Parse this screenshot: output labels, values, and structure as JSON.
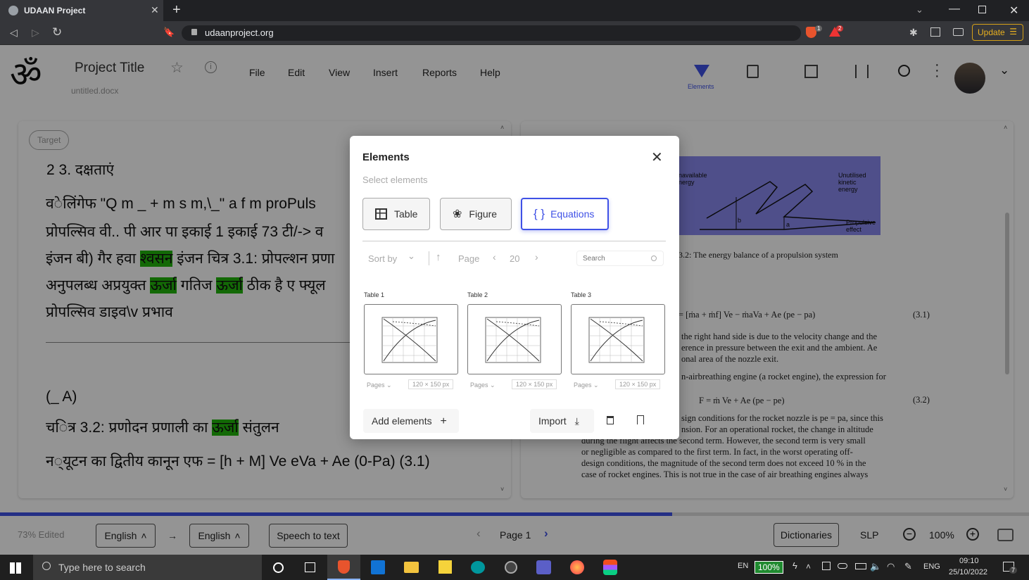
{
  "browser": {
    "tab_title": "UDAAN Project",
    "url": "udaanproject.org",
    "update_label": "Update",
    "brave_badge": "1",
    "alert_badge": "2"
  },
  "app": {
    "project_title": "Project Title",
    "file_name": "untitled.docx",
    "menu": [
      "File",
      "Edit",
      "View",
      "Insert",
      "Reports",
      "Help"
    ],
    "elements_label": "Elements"
  },
  "left_panel": {
    "target_label": "Target",
    "lines": [
      "2 3. दक्षताएं",
      "व◌ेलिंगेफ \"Q m _ + m s m,\\_\" a f m proPuls",
      "प्रोपल्सिव वी.. पी आर पा इकाई 1 इकाई 73 टी/-> व",
      "इंजन बी) गैर हवा",
      "अनुपलब्ध अप्रयुक्त",
      "प्रोपल्सिव डाइव\\v प्रभाव",
      "(_ A)",
      "च◌ित्र 3.2: प्रणोदन प्रणाली का",
      "न◌्यूटन का द्वितीय कानून एफ = [h + M] Ve eVa + Ae (0-Pa) (3.1)"
    ],
    "hl1": "श्वसन",
    "l4_rest": " इंजन चित्र 3.1: प्रोपल्शन प्रणा",
    "hl2": "ऊर्जा",
    "l5_mid": " गतिज ",
    "hl3": "ऊर्जा",
    "l5_rest": " ठीक है ए फ्यूल",
    "hl4": "ऊर्जा",
    "l8_rest": " संतुलन"
  },
  "right_panel": {
    "fig_labels": [
      "navailable",
      "nergy",
      "Unutilised",
      "kinetic",
      "energy",
      "Propulsive",
      "effect",
      "b",
      "a"
    ],
    "caption": "3.2: The energy balance of a propulsion system",
    "eq1": "= [ṁa + ṁf] Ve − ṁaVa + Ae (pe − pa)",
    "eq1_no": "(3.1)",
    "text1": [
      "the right hand side is due to the velocity change and the",
      "erence in pressure between the exit and the ambient. Ae",
      "onal area of the nozzle exit.",
      "n-airbreathing engine (a rocket engine), the expression for"
    ],
    "eq2": "F = ṁ Ve + Ae (pe − pe)",
    "eq2_no": "(3.2)",
    "text2": [
      "sign conditions for the rocket nozzle is pe = pa, since this",
      "nsion. For an operational rocket, the change in altitude",
      "during the flight affects the second term. However, the second term is very small",
      "or negligible as compared to the first term. In fact, in the worst operating off-",
      "design conditions, the magnitude of the second term does not exceed 10 % in the",
      "case of rocket engines. This is not true in the case of air breathing engines always"
    ]
  },
  "modal": {
    "title": "Elements",
    "subtitle": "Select elements",
    "types": [
      "Table",
      "Figure",
      "Equations"
    ],
    "sort_label": "Sort by",
    "page_label": "Page",
    "page_value": "20",
    "search_placeholder": "Search",
    "items": [
      {
        "label": "Table 1",
        "pages": "Pages",
        "size": "120 × 150 px"
      },
      {
        "label": "Table 2",
        "pages": "Pages",
        "size": "120 × 150 px"
      },
      {
        "label": "Table 3",
        "pages": "Pages",
        "size": "120 × 150 px"
      }
    ],
    "add_label": "Add elements",
    "import_label": "Import"
  },
  "bottom": {
    "edited": "73% Edited",
    "lang_from": "English",
    "lang_to": "English",
    "speech": "Speech to text",
    "page": "Page 1",
    "dictionaries": "Dictionaries",
    "slp": "SLP",
    "zoom": "100%",
    "progress": 0.653
  },
  "taskbar": {
    "search_placeholder": "Type here to search",
    "lang_short": "EN",
    "battery": "100%",
    "lang_long": "ENG",
    "time": "09:10",
    "date": "25/10/2022",
    "notif": "7"
  },
  "colors": {
    "accent": "#3f51e6",
    "highlight": "#22b50c",
    "figure_bg": "#8888ee"
  }
}
